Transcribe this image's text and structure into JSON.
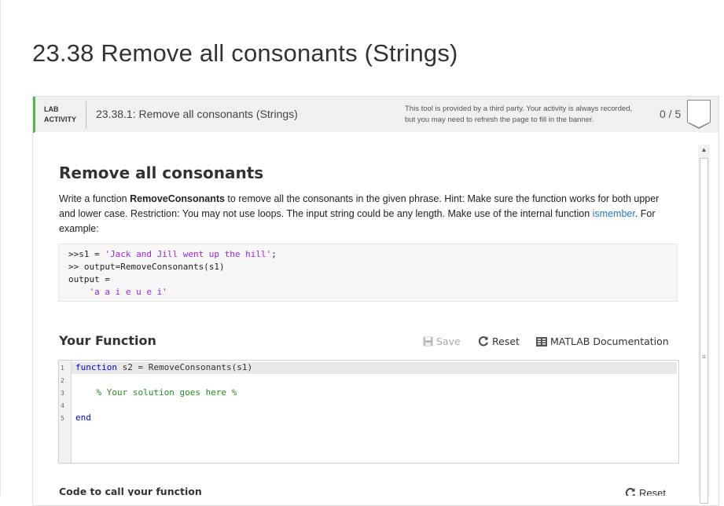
{
  "page": {
    "title": "23.38 Remove all consonants (Strings)"
  },
  "lab_header": {
    "tag_line1": "LAB",
    "tag_line2": "ACTIVITY",
    "name": "23.38.1: Remove all consonants (Strings)",
    "notice_line1": "This tool is provided by a third party. Your activity is always recorded,",
    "notice_line2": "but you may need to refresh the page to fill in the banner.",
    "score": "0 / 5"
  },
  "problem": {
    "heading": "Remove all consonants",
    "desc_1": " Write a function ",
    "desc_fn": "RemoveConsonants",
    "desc_2": " to remove all the consonants in the given phrase.  Hint:  Make sure the function works for both upper and lower case.  Restriction:  You may not use loops.  The input string could be any length.  Make use of the internal function ",
    "desc_link": "ismember",
    "desc_3": ".  For example:",
    "example": {
      "l1_a": ">>s1 = ",
      "l1_str": "'Jack and Jill went up the hill'",
      "l1_b": ";",
      "l2": ">> output=RemoveConsonants(s1)",
      "l3": "output =",
      "l4": "    'a a i e u e i'"
    }
  },
  "your_function": {
    "heading": "Your Function",
    "save_label": "Save",
    "reset_label": "Reset",
    "doc_label": "MATLAB Documentation",
    "line_numbers": [
      "1",
      "2",
      "3",
      "4",
      "5"
    ],
    "code_l1_kw": "function",
    "code_l1_rest": " s2 = RemoveConsonants(s1)",
    "code_l3": "    % Your solution goes here %",
    "code_l5": "end"
  },
  "call_section": {
    "heading": "Code to call your function",
    "reset_label": "Reset"
  },
  "icons": [
    "save-icon",
    "reset-icon",
    "documentation-icon",
    "scroll-up-icon",
    "scroll-grip-icon",
    "score-badge-icon"
  ],
  "colors": {
    "accent": "#5ab552",
    "link": "#2a78c2",
    "keyword": "#0000ff",
    "string": "#a020f0",
    "comment": "#228b22"
  }
}
